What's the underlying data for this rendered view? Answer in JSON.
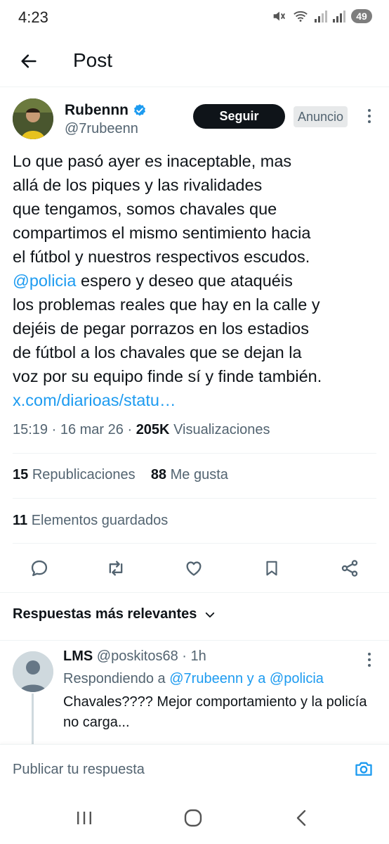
{
  "status_bar": {
    "time": "4:23",
    "battery": "49"
  },
  "header": {
    "title": "Post",
    "back_icon": "arrow-left-icon"
  },
  "post": {
    "author": {
      "name": "Rubennn",
      "handle": "@7rubeenn",
      "verified": true
    },
    "follow_label": "Seguir",
    "ad_label": "Anuncio",
    "text_lines": [
      "Lo que pasó ayer es inaceptable, mas",
      "allá de los piques y las rivalidades",
      "que tengamos, somos chavales que",
      "compartimos el mismo sentimiento hacia",
      "el fútbol y nuestros respectivos escudos."
    ],
    "mention": "@policia",
    "text_after_mention": " espero y deseo que ataquéis",
    "text_lines_2": [
      "los problemas reales que hay en la calle y",
      "dejéis de pegar porrazos en los estadios",
      "de fútbol a los chavales que se dejan la",
      "voz por su equipo finde sí y finde también."
    ],
    "link": "x.com/diarioas/statu…",
    "time": "15:19",
    "date": "16 mar 26",
    "views_count": "205K",
    "views_label": "Visualizaciones",
    "reposts_count": "15",
    "reposts_label": "Republicaciones",
    "likes_count": "88",
    "likes_label": "Me gusta",
    "bookmarks_count": "11",
    "bookmarks_label": "Elementos guardados"
  },
  "actions": [
    "reply-icon",
    "repost-icon",
    "like-icon",
    "bookmark-icon",
    "share-icon"
  ],
  "replies_sort_label": "Respuestas más relevantes",
  "reply": {
    "name": "LMS",
    "handle": "@poskitos68",
    "age": "1h",
    "replying_prefix": "Respondiendo a",
    "replying_to_1": "@7rubeenn",
    "replying_and": "y a",
    "replying_to_2": "@policia",
    "text": "Chavales???? Mejor comportamiento y la policía no carga..."
  },
  "reply_bar": {
    "placeholder": "Publicar tu respuesta"
  },
  "colors": {
    "accent": "#1d9bf0",
    "text": "#0f1419",
    "secondary": "#536471"
  }
}
